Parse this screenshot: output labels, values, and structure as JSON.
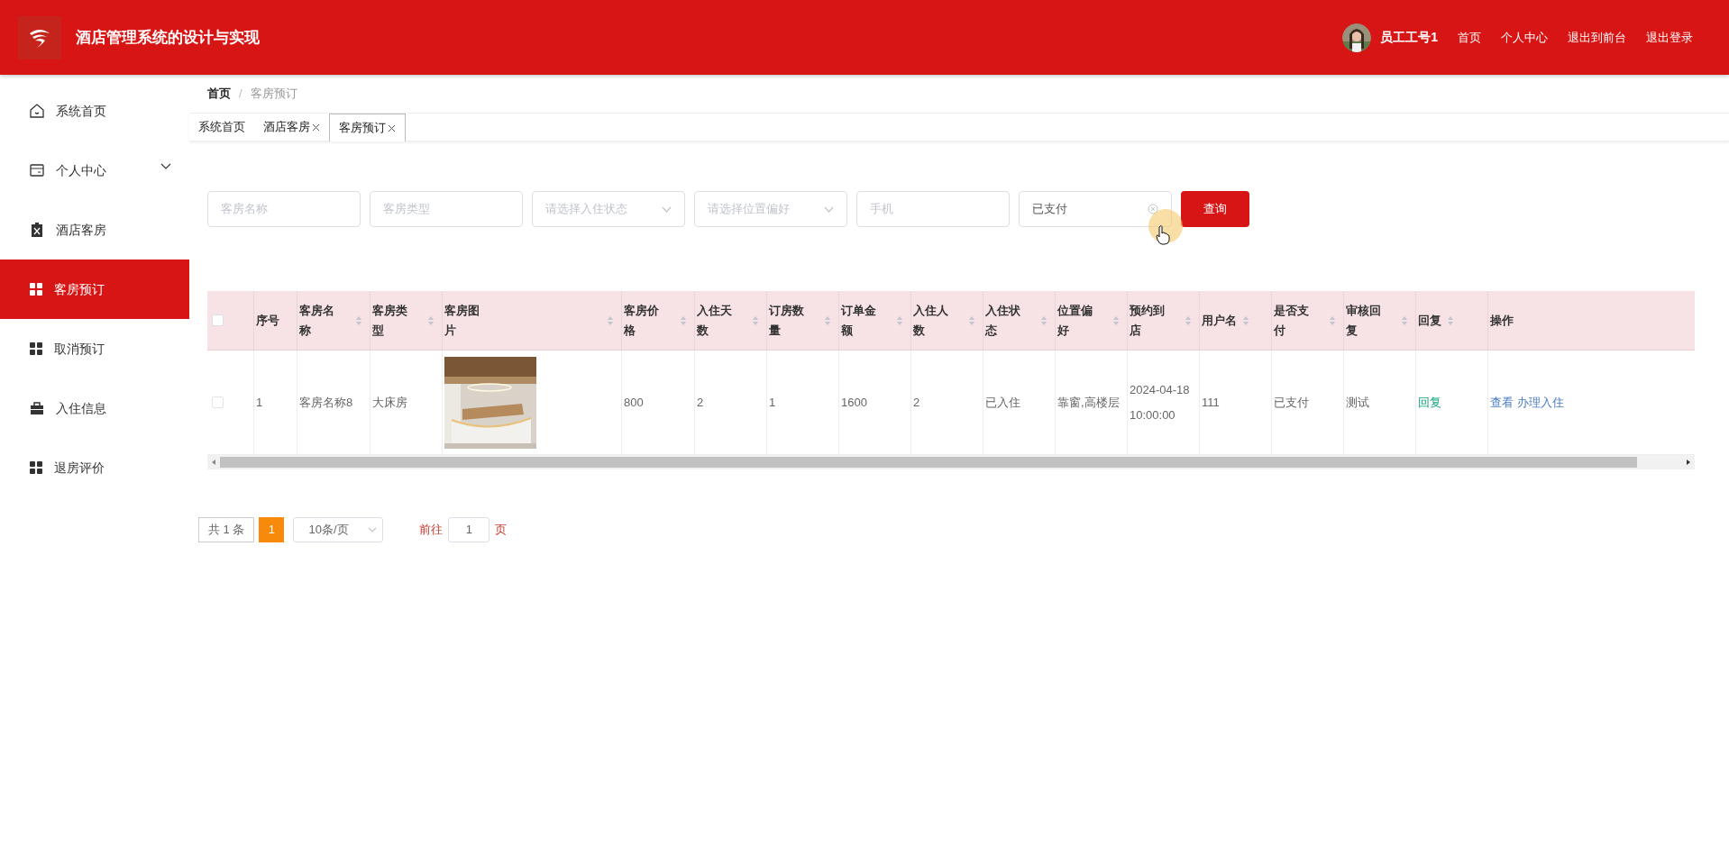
{
  "header": {
    "title": "酒店管理系统的设计与实现",
    "user": "员工工号1",
    "nav": [
      "首页",
      "个人中心",
      "退出到前台",
      "退出登录"
    ]
  },
  "sidebar": {
    "items": [
      {
        "label": "系统首页",
        "selected": false,
        "expandable": false
      },
      {
        "label": "个人中心",
        "selected": false,
        "expandable": true
      },
      {
        "label": "酒店客房",
        "selected": false,
        "expandable": false
      },
      {
        "label": "客房预订",
        "selected": true,
        "expandable": false
      },
      {
        "label": "取消预订",
        "selected": false,
        "expandable": false
      },
      {
        "label": "入住信息",
        "selected": false,
        "expandable": false
      },
      {
        "label": "退房评价",
        "selected": false,
        "expandable": false
      }
    ]
  },
  "breadcrumb": [
    "首页",
    "客房预订"
  ],
  "breadcrumb_separator": "/",
  "tabs": [
    {
      "label": "系统首页",
      "closable": false,
      "selected": false
    },
    {
      "label": "酒店客房",
      "closable": true,
      "selected": false
    },
    {
      "label": "客房预订",
      "closable": true,
      "selected": true
    }
  ],
  "search": {
    "fields": [
      {
        "kind": "input",
        "placeholder": "客房名称"
      },
      {
        "kind": "input",
        "placeholder": "客房类型"
      },
      {
        "kind": "select",
        "placeholder": "请选择入住状态"
      },
      {
        "kind": "select",
        "placeholder": "请选择位置偏好"
      },
      {
        "kind": "input",
        "placeholder": "手机"
      },
      {
        "kind": "clearable",
        "value": "已支付"
      }
    ],
    "button": "查询"
  },
  "table": {
    "all_checked": false,
    "columns": [
      {
        "label": "序号",
        "sortable": false
      },
      {
        "label": "客房名称",
        "sortable": true
      },
      {
        "label": "客房类型",
        "sortable": true
      },
      {
        "label": "客房图片",
        "sortable": true
      },
      {
        "label": "客房价格",
        "sortable": true
      },
      {
        "label": "入住天数",
        "sortable": true
      },
      {
        "label": "订房数量",
        "sortable": true
      },
      {
        "label": "订单金额",
        "sortable": true
      },
      {
        "label": "入住人数",
        "sortable": true
      },
      {
        "label": "入住状态",
        "sortable": true
      },
      {
        "label": "位置偏好",
        "sortable": true
      },
      {
        "label": "预约到店",
        "sortable": true
      },
      {
        "label": "用户名",
        "sortable": true
      },
      {
        "label": "是否支付",
        "sortable": true
      },
      {
        "label": "审核回复",
        "sortable": true
      },
      {
        "label": "回复",
        "sortable": true
      },
      {
        "label": "操作",
        "sortable": false
      }
    ],
    "rows": [
      {
        "checked": false,
        "cells": [
          "1",
          "客房名称8",
          "大床房",
          {
            "kind": "picture"
          },
          "800",
          "2",
          "1",
          "1600",
          "2",
          "已入住",
          "靠窗,高楼层",
          "2024-04-18 10:00:00",
          "111",
          "已支付",
          "测试"
        ],
        "reply": "回复",
        "actions": [
          "查看",
          "办理入住"
        ]
      }
    ]
  },
  "pagination": {
    "total": "共 1 条",
    "pages": [
      {
        "label": "1",
        "selected": true
      }
    ],
    "page_size": "10条/页",
    "goto": "前往",
    "goto_value": "1",
    "page_suffix": "页"
  }
}
